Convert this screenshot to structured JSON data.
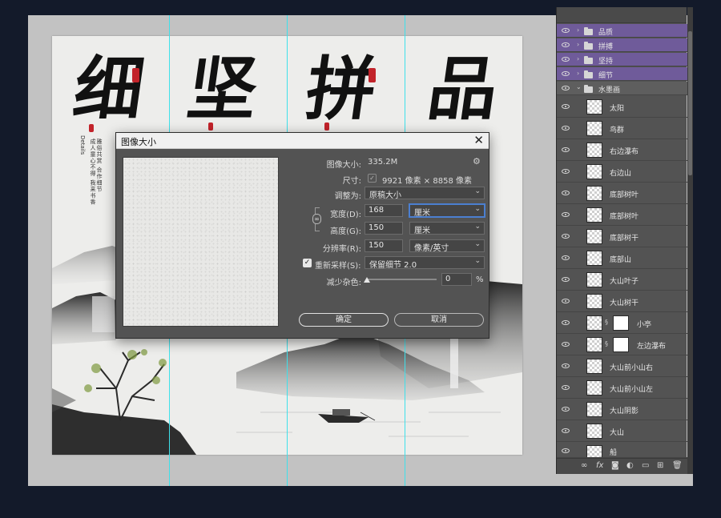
{
  "artwork": {
    "big_chars": [
      "细",
      "坚",
      "拼",
      "品"
    ],
    "vertical_text_1": "成人童心不得 我来书香",
    "vertical_text_2": "雅俗共赏 合作细节",
    "vertical_en": "Details"
  },
  "dialog": {
    "title": "图像大小",
    "image_size_label": "图像大小:",
    "image_size_value": "335.2M",
    "dimensions_label": "尺寸:",
    "dimensions_value": "9921 像素 × 8858 像素",
    "fit_label": "调整为:",
    "fit_value": "原稿大小",
    "width_label": "宽度(D):",
    "width_value": "168",
    "width_unit": "厘米",
    "height_label": "高度(G):",
    "height_value": "150",
    "height_unit": "厘米",
    "resolution_label": "分辨率(R):",
    "resolution_value": "150",
    "resolution_unit": "像素/英寸",
    "resample_label": "重新采样(S):",
    "resample_value": "保留细节 2.0",
    "reduce_noise_label": "减少杂色:",
    "reduce_noise_value": "0",
    "reduce_noise_unit": "%",
    "ok_label": "确定",
    "cancel_label": "取消"
  },
  "layers": {
    "groups": [
      "品质",
      "拼搏",
      "坚持",
      "细节"
    ],
    "open_group": "水墨画",
    "items": [
      "太阳",
      "鸟群",
      "右边瀑布",
      "右边山",
      "底部树叶",
      "底部树叶",
      "底部树干",
      "底部山",
      "大山叶子",
      "大山树干",
      "小亭",
      "左边瀑布",
      "大山前小山右",
      "大山前小山左",
      "大山阴影",
      "大山",
      "船"
    ]
  },
  "colors": {
    "group_highlight": "#6f5b9a",
    "guide": "#3ee0ea",
    "seal_red": "#c2232a"
  }
}
